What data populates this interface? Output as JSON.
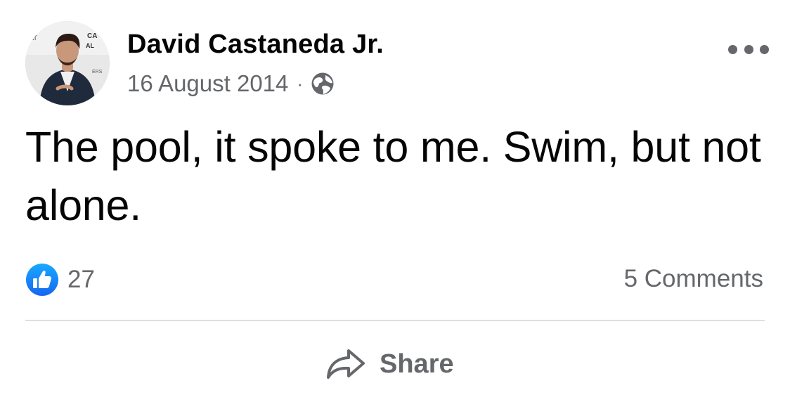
{
  "post": {
    "author": "David Castaneda Jr.",
    "date": "16 August 2014",
    "separator": "·",
    "privacy_icon": "globe-icon",
    "more_icon": "ellipsis-icon",
    "text": "The pool, it spoke to me. Swim, but not alone."
  },
  "engagement": {
    "reaction_icon": "like-icon",
    "reaction_count": "27",
    "comments": "5 Comments"
  },
  "actions": {
    "share_icon": "share-arrow-icon",
    "share_label": "Share"
  },
  "colors": {
    "primary_text": "#050505",
    "secondary_text": "#65676b",
    "like_blue": "#1877f2",
    "divider": "#dddfe2"
  }
}
